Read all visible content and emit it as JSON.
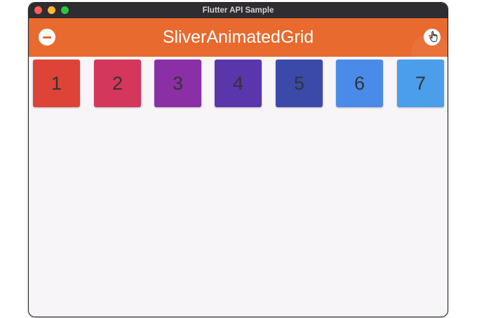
{
  "window": {
    "title": "Flutter API Sample"
  },
  "appbar": {
    "title": "SliverAnimatedGrid",
    "remove_icon": "remove-circle-icon",
    "add_icon": "add-circle-icon"
  },
  "grid": {
    "items": [
      {
        "label": "1",
        "color": "#dd4336"
      },
      {
        "label": "2",
        "color": "#d5365b"
      },
      {
        "label": "3",
        "color": "#8b2fa6"
      },
      {
        "label": "4",
        "color": "#5a36ad"
      },
      {
        "label": "5",
        "color": "#3b4aa9"
      },
      {
        "label": "6",
        "color": "#4a8bea"
      },
      {
        "label": "7",
        "color": "#4a9eea"
      }
    ]
  }
}
